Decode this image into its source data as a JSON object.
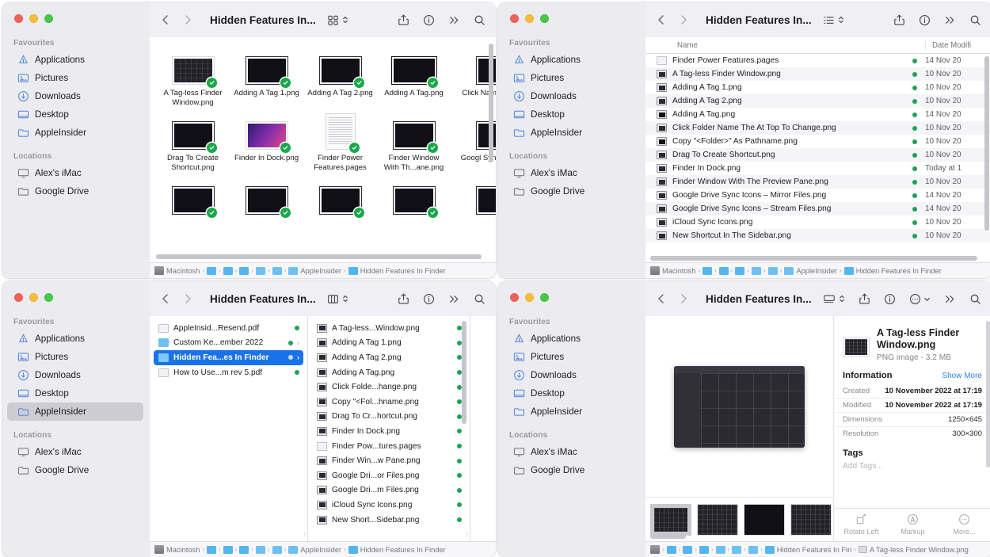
{
  "sidebar": {
    "favourites_label": "Favourites",
    "locations_label": "Locations",
    "favourites": [
      {
        "label": "Applications",
        "icon": "applications-icon"
      },
      {
        "label": "Pictures",
        "icon": "pictures-icon"
      },
      {
        "label": "Downloads",
        "icon": "downloads-icon"
      },
      {
        "label": "Desktop",
        "icon": "desktop-icon"
      },
      {
        "label": "AppleInsider",
        "icon": "folder-icon"
      }
    ],
    "locations": [
      {
        "label": "Alex's iMac",
        "icon": "imac-icon"
      },
      {
        "label": "Google Drive",
        "icon": "folder-icon"
      }
    ],
    "selected": "AppleInsider"
  },
  "toolbar": {
    "title": "Hidden Features In...",
    "back_icon": "chevron-left-icon",
    "forward_icon": "chevron-right-icon",
    "share_icon": "share-icon",
    "info_icon": "info-circle-icon",
    "more_icon": "ellipsis-circle-icon",
    "overflow_icon": "double-chevron-right-icon",
    "search_icon": "search-icon",
    "view_icon_grid": "icon-view-icon",
    "view_icon_list": "list-view-icon",
    "view_icon_column": "column-view-icon",
    "view_icon_gallery": "gallery-view-icon",
    "stepper_icon": "chevron-up-down-icon"
  },
  "pathbar": {
    "items": [
      {
        "label": "Macintosh",
        "icon": "disk-icon"
      },
      {
        "label": "",
        "icon": "folder-icon"
      },
      {
        "label": "",
        "icon": "folder-icon"
      },
      {
        "label": "",
        "icon": "folder-icon"
      },
      {
        "label": "",
        "icon": "folder-icon"
      },
      {
        "label": "",
        "icon": "folder-icon"
      },
      {
        "label": "AppleInsider",
        "icon": "folder-icon"
      },
      {
        "label": "Hidden Features In Finder",
        "icon": "folder-icon"
      }
    ],
    "gallery_items": [
      {
        "label": "",
        "icon": "disk-icon"
      },
      {
        "label": "",
        "icon": "folder-icon"
      },
      {
        "label": "",
        "icon": "folder-icon"
      },
      {
        "label": "",
        "icon": "folder-icon"
      },
      {
        "label": "",
        "icon": "folder-icon"
      },
      {
        "label": "",
        "icon": "folder-icon"
      },
      {
        "label": "",
        "icon": "folder-icon"
      },
      {
        "label": "Hidden Features In Fin",
        "icon": "folder-icon"
      },
      {
        "label": "A Tag-less Finder Window.png",
        "icon": "png-icon"
      }
    ]
  },
  "icon_view": {
    "items": [
      {
        "name": "A Tag-less Finder Window.png",
        "kind": "png",
        "style": "grid",
        "badge": true
      },
      {
        "name": "Adding A Tag 1.png",
        "kind": "png",
        "style": "dark",
        "badge": true
      },
      {
        "name": "Adding A Tag 2.png",
        "kind": "png",
        "style": "dark",
        "badge": true
      },
      {
        "name": "Adding A Tag.png",
        "kind": "png",
        "style": "wide",
        "badge": true
      },
      {
        "name": "Click Name T...",
        "kind": "png",
        "style": "dark",
        "badge": true
      },
      {
        "name": "Drag To Create Shortcut.png",
        "kind": "png",
        "style": "dark",
        "badge": true
      },
      {
        "name": "Finder In Dock.png",
        "kind": "png",
        "style": "purple",
        "badge": true
      },
      {
        "name": "Finder Power Features.pages",
        "kind": "pages",
        "style": "doc",
        "badge": true
      },
      {
        "name": "Finder Window With Th...ane.png",
        "kind": "png",
        "style": "dark",
        "badge": true
      },
      {
        "name": "Googl Sync Ic...",
        "kind": "png",
        "style": "dark",
        "badge": true
      },
      {
        "name": "",
        "kind": "png",
        "style": "dark",
        "badge": true
      },
      {
        "name": "",
        "kind": "png",
        "style": "dark",
        "badge": true
      },
      {
        "name": "",
        "kind": "png",
        "style": "dark",
        "badge": true
      },
      {
        "name": "",
        "kind": "png",
        "style": "dark",
        "badge": true
      },
      {
        "name": "",
        "kind": "png",
        "style": "dark",
        "badge": true
      }
    ]
  },
  "list_view": {
    "columns": {
      "name": "Name",
      "date_modified": "Date Modifi"
    },
    "rows": [
      {
        "name": "Finder Power Features.pages",
        "kind": "pages",
        "date": "14 Nov 20"
      },
      {
        "name": "A Tag-less Finder Window.png",
        "kind": "png",
        "date": "10 Nov 20"
      },
      {
        "name": "Adding A Tag 1.png",
        "kind": "png",
        "date": "10 Nov 20"
      },
      {
        "name": "Adding A Tag 2.png",
        "kind": "png",
        "date": "10 Nov 20"
      },
      {
        "name": "Adding A Tag.png",
        "kind": "png-wide",
        "date": "14 Nov 20"
      },
      {
        "name": "Click Folder Name The At Top To Change.png",
        "kind": "png",
        "date": "10 Nov 20"
      },
      {
        "name": "Copy \"<Folder>\" As Pathname.png",
        "kind": "png-wide",
        "date": "10 Nov 20"
      },
      {
        "name": "Drag To Create Shortcut.png",
        "kind": "png",
        "date": "10 Nov 20"
      },
      {
        "name": "Finder In Dock.png",
        "kind": "png",
        "date": "Today at 1"
      },
      {
        "name": "Finder Window With The Preview Pane.png",
        "kind": "png",
        "date": "10 Nov 20"
      },
      {
        "name": "Google Drive Sync Icons – Mirror Files.png",
        "kind": "png",
        "date": "14 Nov 20"
      },
      {
        "name": "Google Drive Sync Icons – Stream Files.png",
        "kind": "png",
        "date": "14 Nov 20"
      },
      {
        "name": "iCloud Sync Icons.png",
        "kind": "png",
        "date": "10 Nov 20"
      },
      {
        "name": "New Shortcut In The Sidebar.png",
        "kind": "png",
        "date": "10 Nov 20"
      }
    ]
  },
  "column_view": {
    "column1": [
      {
        "name": "AppleInsid...Resend.pdf",
        "kind": "pdf",
        "dot": true,
        "arrow": false,
        "selected": false
      },
      {
        "name": "Custom Ke...ember 2022",
        "kind": "folder",
        "dot": true,
        "arrow": true,
        "selected": false
      },
      {
        "name": "Hidden Fea...es In Finder",
        "kind": "folder",
        "dot": true,
        "arrow": true,
        "selected": true
      },
      {
        "name": "How to Use...m rev 5.pdf",
        "kind": "pdf",
        "dot": true,
        "arrow": false,
        "selected": false
      }
    ],
    "column2": [
      {
        "name": "A Tag-less...Window.png",
        "kind": "png",
        "dot": true
      },
      {
        "name": "Adding A Tag 1.png",
        "kind": "png",
        "dot": true
      },
      {
        "name": "Adding A Tag 2.png",
        "kind": "png",
        "dot": true
      },
      {
        "name": "Adding A Tag.png",
        "kind": "png",
        "dot": true
      },
      {
        "name": "Click Folde...hange.png",
        "kind": "png",
        "dot": true
      },
      {
        "name": "Copy \"<Fol...hname.png",
        "kind": "png",
        "dot": true
      },
      {
        "name": "Drag To Cr...hortcut.png",
        "kind": "png",
        "dot": true
      },
      {
        "name": "Finder In Dock.png",
        "kind": "png",
        "dot": true
      },
      {
        "name": "Finder Pow...tures.pages",
        "kind": "pages",
        "dot": true
      },
      {
        "name": "Finder Win...w Pane.png",
        "kind": "png",
        "dot": true
      },
      {
        "name": "Google Dri...or Files.png",
        "kind": "png",
        "dot": true
      },
      {
        "name": "Google Dri...m Files.png",
        "kind": "png",
        "dot": true
      },
      {
        "name": "iCloud Sync Icons.png",
        "kind": "png",
        "dot": true
      },
      {
        "name": "New Short...Sidebar.png",
        "kind": "png",
        "dot": true
      }
    ]
  },
  "preview": {
    "title": "A Tag-less Finder Window.png",
    "subtitle": "PNG image - 3.2 MB",
    "information_label": "Information",
    "show_more_label": "Show More",
    "rows": [
      {
        "key": "Created",
        "value": "10 November 2022 at 17:19"
      },
      {
        "key": "Modified",
        "value": "10 November 2022 at 17:19"
      },
      {
        "key": "Dimensions",
        "value": "1250×645"
      },
      {
        "key": "Resolution",
        "value": "300×300"
      }
    ],
    "tags_label": "Tags",
    "add_tags_placeholder": "Add Tags...",
    "actions": [
      {
        "label": "Rotate Left",
        "icon": "rotate-left-icon"
      },
      {
        "label": "Markup",
        "icon": "markup-icon"
      },
      {
        "label": "More...",
        "icon": "ellipsis-circle-icon"
      }
    ]
  },
  "colors": {
    "accent_blue": "#1a72e8",
    "sidebar_bg": "#ecebef",
    "toolbar_bg": "#f0eff3",
    "sync_dot_green": "#22a05a",
    "link_blue": "#2f7df0"
  }
}
